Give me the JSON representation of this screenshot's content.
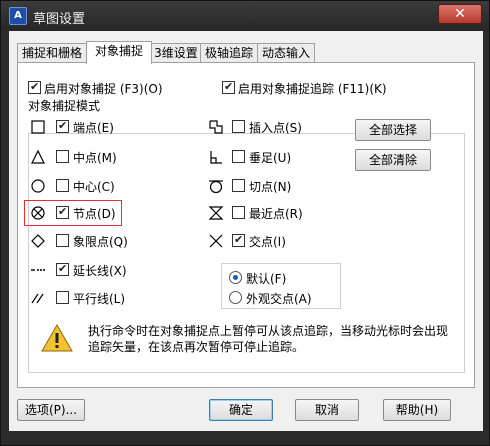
{
  "window": {
    "title": "草图设置",
    "close_glyph": "✕"
  },
  "tabs": [
    "捕捉和栅格",
    "对象捕捉",
    "3维设置",
    "极轴追踪",
    "动态输入"
  ],
  "top_options": {
    "enable_osnap": "启用对象捕捉 (F3)(O)",
    "enable_tracking": "启用对象捕捉追踪 (F11)(K)"
  },
  "group_title": "对象捕捉模式",
  "left_modes": [
    {
      "label": "端点(E)",
      "checked": true,
      "symbol": "square"
    },
    {
      "label": "中点(M)",
      "checked": false,
      "symbol": "triangle"
    },
    {
      "label": "中心(C)",
      "checked": false,
      "symbol": "circle"
    },
    {
      "label": "节点(D)",
      "checked": true,
      "symbol": "node"
    },
    {
      "label": "象限点(Q)",
      "checked": false,
      "symbol": "diamond"
    },
    {
      "label": "延长线(X)",
      "checked": true,
      "symbol": "extension"
    },
    {
      "label": "平行线(L)",
      "checked": false,
      "symbol": "parallel"
    }
  ],
  "right_modes": [
    {
      "label": "插入点(S)",
      "checked": false,
      "symbol": "insert"
    },
    {
      "label": "垂足(U)",
      "checked": false,
      "symbol": "perpendicular"
    },
    {
      "label": "切点(N)",
      "checked": false,
      "symbol": "tangent"
    },
    {
      "label": "最近点(R)",
      "checked": false,
      "symbol": "nearest"
    },
    {
      "label": "交点(I)",
      "checked": true,
      "symbol": "intersection"
    }
  ],
  "buttons": {
    "select_all": "全部选择",
    "clear_all": "全部清除",
    "options": "选项(P)...",
    "ok": "确定",
    "cancel": "取消",
    "help": "帮助(H)"
  },
  "radios": {
    "default": "默认(F)",
    "apparent": "外观交点(A)"
  },
  "warning_text": "执行命令时在对象捕捉点上暂停可从该点追踪，当移动光标时会出现追踪矢量，在该点再次暂停可停止追踪。",
  "colors": {
    "highlight": "#e03030",
    "warning": "#f2c230",
    "accent": "#3c7fb1"
  }
}
